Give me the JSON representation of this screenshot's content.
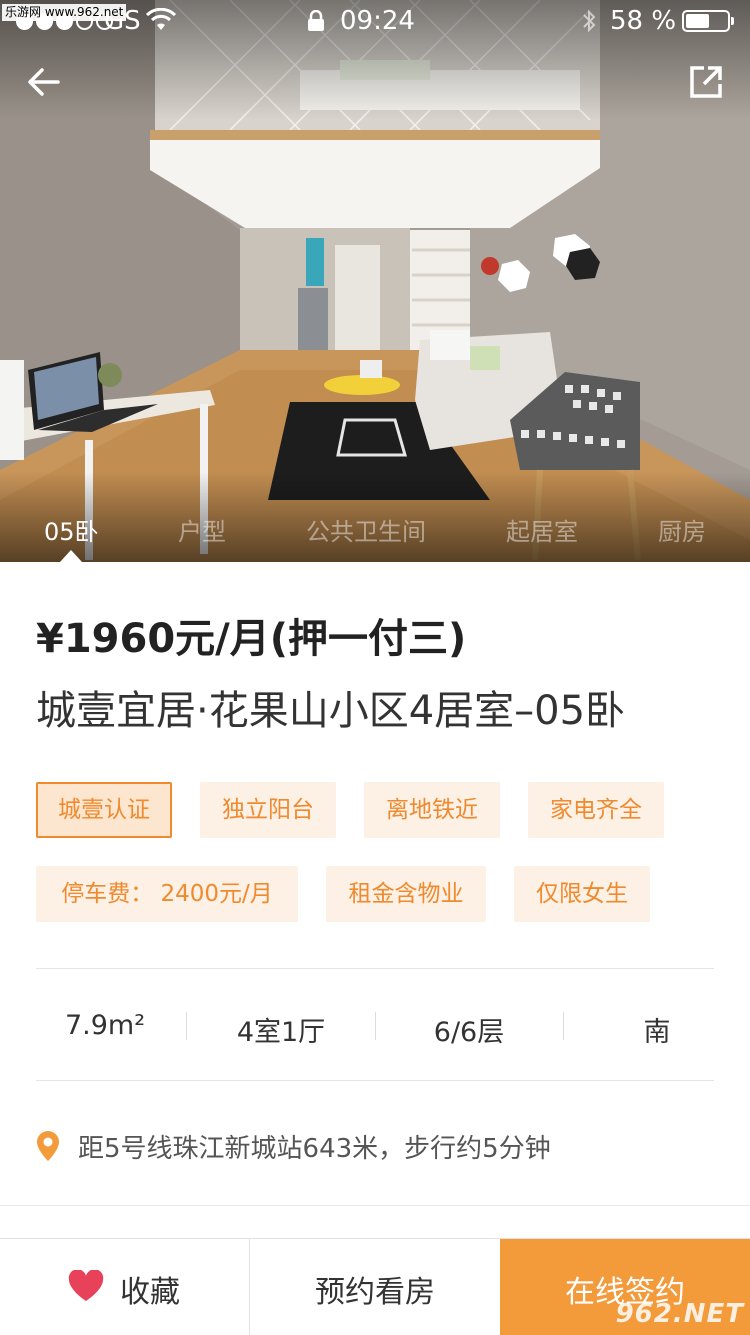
{
  "watermark_top": "乐游网 www.962.net",
  "status_bar": {
    "carrier": "GS",
    "time": "09:24",
    "battery_percent": "58 %",
    "battery_level": 0.58
  },
  "photo_tabs": [
    {
      "label": "05卧",
      "active": true
    },
    {
      "label": "户型",
      "active": false
    },
    {
      "label": "公共卫生间",
      "active": false
    },
    {
      "label": "起居室",
      "active": false
    },
    {
      "label": "厨房",
      "active": false
    }
  ],
  "listing": {
    "price": "¥1960元/月(押一付三)",
    "title": "城壹宜居·花果山小区4居室–05卧"
  },
  "tags": [
    "城壹认证",
    "独立阳台",
    "离地铁近",
    "家电齐全",
    "停车费： 2400元/月",
    "租金含物业",
    "仅限女生"
  ],
  "specs": {
    "area": "7.9m²",
    "layout": "4室1厅",
    "floor": "6/6层",
    "orientation": "南"
  },
  "location": "距5号线珠江新城站643米，步行约5分钟",
  "bottom_bar": {
    "favorite": "收藏",
    "book_viewing": "预约看房",
    "sign_online": "在线签约"
  },
  "watermark_bottom": "962.NET",
  "colors": {
    "accent": "#f39a3b",
    "tag_text": "#ef8a2f",
    "tag_bg": "#fdf0e4",
    "heart": "#e8415a"
  }
}
